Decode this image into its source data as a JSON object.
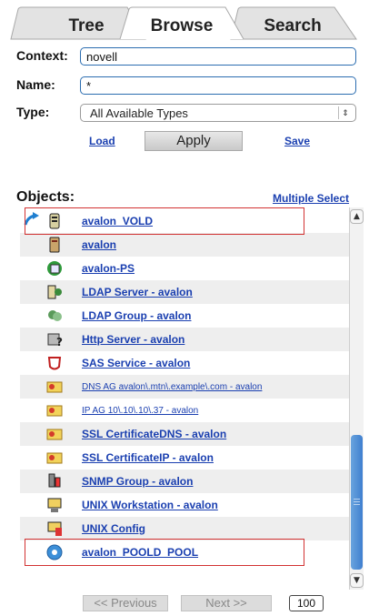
{
  "tabs": [
    {
      "label": "Tree",
      "active": false
    },
    {
      "label": "Browse",
      "active": true
    },
    {
      "label": "Search",
      "active": false
    }
  ],
  "form": {
    "context_label": "Context:",
    "context_value": "novell",
    "name_label": "Name:",
    "name_value": "*",
    "type_label": "Type:",
    "type_value": "All Available Types",
    "load_label": "Load",
    "apply_label": "Apply",
    "save_label": "Save"
  },
  "objects": {
    "title": "Objects:",
    "multiple_select_label": "Multiple Select",
    "items": [
      {
        "name": "avalon_VOLD",
        "icon": "volume-icon",
        "highlighted": true
      },
      {
        "name": "avalon",
        "icon": "server-icon"
      },
      {
        "name": "avalon-PS",
        "icon": "print-server-icon"
      },
      {
        "name": "LDAP Server - avalon",
        "icon": "ldap-server-icon"
      },
      {
        "name": "LDAP Group - avalon",
        "icon": "ldap-group-icon"
      },
      {
        "name": "Http Server - avalon",
        "icon": "http-server-icon"
      },
      {
        "name": "SAS Service - avalon",
        "icon": "sas-service-icon"
      },
      {
        "name": "DNS AG avalon\\.mtn\\.example\\.com - avalon",
        "icon": "certificate-icon"
      },
      {
        "name": "IP AG 10\\.10\\.10\\.37 - avalon",
        "icon": "certificate-icon"
      },
      {
        "name": "SSL CertificateDNS - avalon",
        "icon": "certificate-icon"
      },
      {
        "name": "SSL CertificateIP - avalon",
        "icon": "certificate-icon"
      },
      {
        "name": "SNMP Group - avalon",
        "icon": "snmp-group-icon"
      },
      {
        "name": "UNIX Workstation - avalon",
        "icon": "unix-workstation-icon"
      },
      {
        "name": "UNIX Config",
        "icon": "unix-config-icon"
      },
      {
        "name": "avalon_POOLD_POOL",
        "icon": "pool-icon",
        "highlighted": true
      }
    ]
  },
  "pager": {
    "previous_label": "<< Previous",
    "next_label": "Next >>",
    "page_size": "100"
  },
  "colors": {
    "link": "#1a3fb0",
    "highlight_border": "#d23232",
    "scroll_thumb": "#4a88d4"
  }
}
